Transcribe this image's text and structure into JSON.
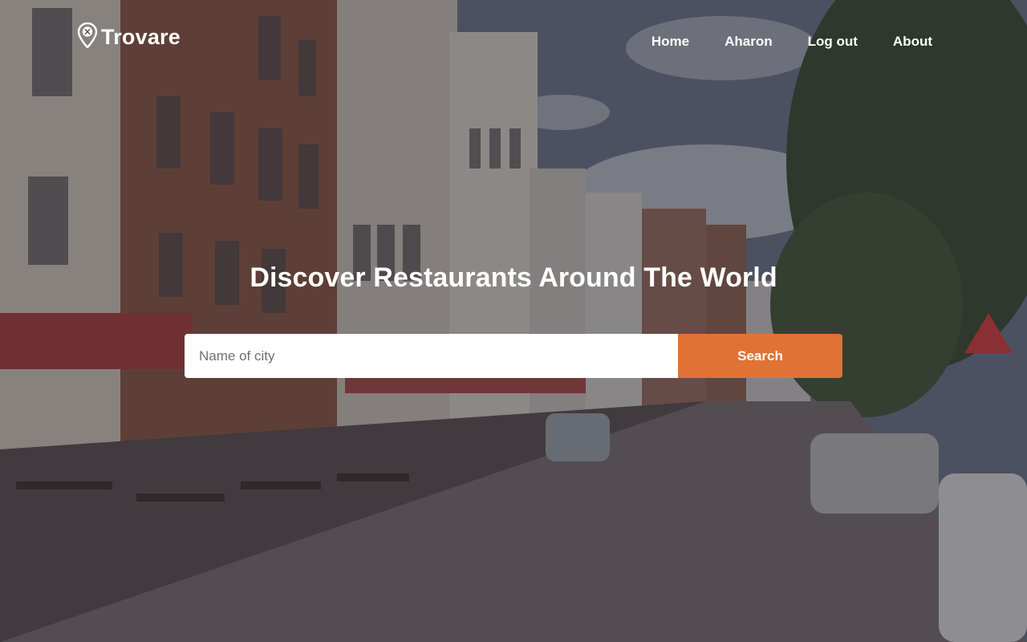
{
  "brand": {
    "name": "Trovare",
    "logo_icon": "map-pin-fork-icon"
  },
  "nav": {
    "items": [
      {
        "label": "Home"
      },
      {
        "label": "Aharon"
      },
      {
        "label": "Log out"
      },
      {
        "label": "About"
      }
    ]
  },
  "hero": {
    "headline": "Discover Restaurants Around The World",
    "background_description_icon": "street-photo"
  },
  "search": {
    "placeholder": "Name of city",
    "value": "",
    "button_label": "Search",
    "button_color": "#e07235"
  },
  "colors": {
    "accent": "#e07235",
    "text_on_dark": "#ffffff"
  }
}
